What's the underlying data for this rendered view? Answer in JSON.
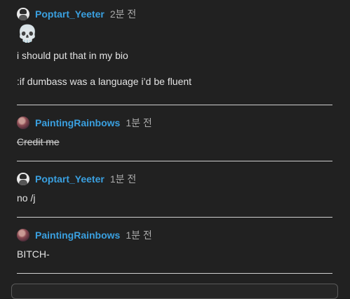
{
  "messages": [
    {
      "username": "Poptart_Yeeter",
      "time": "2분 전",
      "emoji": "💀",
      "lines": [
        "i should put that in my bio",
        ":if dumbass was a language i’d be fluent"
      ]
    },
    {
      "username": "PaintingRainbows",
      "time": "1분 전",
      "text": "Credit me"
    },
    {
      "username": "Poptart_Yeeter",
      "time": "1분 전",
      "text": "no /j"
    },
    {
      "username": "PaintingRainbows",
      "time": "1분 전",
      "text": "BITCH-"
    }
  ],
  "colors": {
    "background": "#212121",
    "username": "#3aa0e0",
    "timestamp": "#aaaaaa"
  }
}
